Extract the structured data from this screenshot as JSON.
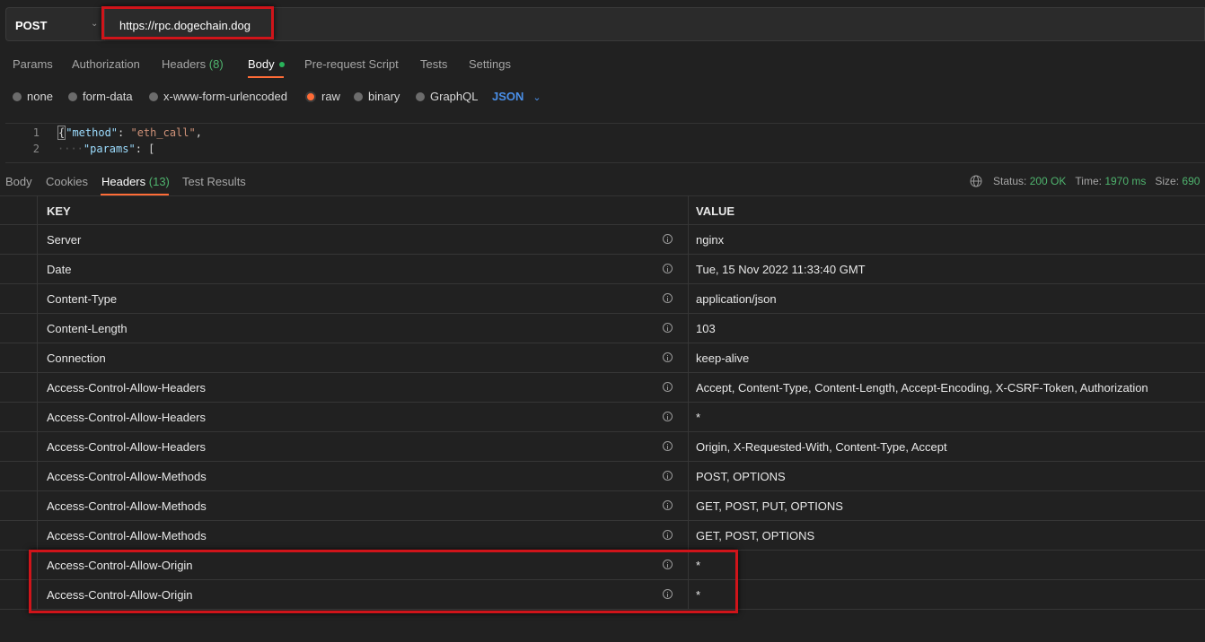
{
  "request": {
    "method": "POST",
    "url": "https://rpc.dogechain.dog"
  },
  "request_tabs": [
    {
      "label": "Params"
    },
    {
      "label": "Authorization"
    },
    {
      "label": "Headers",
      "count": "(8)"
    },
    {
      "label": "Body"
    },
    {
      "label": "Pre-request Script"
    },
    {
      "label": "Tests"
    },
    {
      "label": "Settings"
    }
  ],
  "body_types": [
    "none",
    "form-data",
    "x-www-form-urlencoded",
    "raw",
    "binary",
    "GraphQL"
  ],
  "selected_body_type": "raw",
  "body_format": "JSON",
  "editor": {
    "lines": [
      {
        "n": "1",
        "key": "\"method\"",
        "colon": ": ",
        "value": "\"eth_call\"",
        "tail": ","
      },
      {
        "n": "2",
        "key": "\"params\"",
        "colon": ": ",
        "value": "[",
        "tail": ""
      }
    ]
  },
  "response_tabs": [
    {
      "label": "Body"
    },
    {
      "label": "Cookies"
    },
    {
      "label": "Headers",
      "count": "(13)"
    },
    {
      "label": "Test Results"
    }
  ],
  "status": {
    "status_label": "Status:",
    "status_value": "200 OK",
    "time_label": "Time:",
    "time_value": "1970 ms",
    "size_label": "Size:",
    "size_value": "690"
  },
  "headers_table": {
    "columns": [
      "KEY",
      "VALUE"
    ],
    "rows": [
      {
        "key": "Server",
        "value": "nginx"
      },
      {
        "key": "Date",
        "value": "Tue, 15 Nov 2022 11:33:40 GMT"
      },
      {
        "key": "Content-Type",
        "value": "application/json"
      },
      {
        "key": "Content-Length",
        "value": "103"
      },
      {
        "key": "Connection",
        "value": "keep-alive"
      },
      {
        "key": "Access-Control-Allow-Headers",
        "value": "Accept, Content-Type, Content-Length, Accept-Encoding, X-CSRF-Token, Authorization"
      },
      {
        "key": "Access-Control-Allow-Headers",
        "value": "*"
      },
      {
        "key": "Access-Control-Allow-Headers",
        "value": "Origin, X-Requested-With, Content-Type, Accept"
      },
      {
        "key": "Access-Control-Allow-Methods",
        "value": "POST, OPTIONS"
      },
      {
        "key": "Access-Control-Allow-Methods",
        "value": "GET, POST, PUT, OPTIONS"
      },
      {
        "key": "Access-Control-Allow-Methods",
        "value": "GET, POST, OPTIONS"
      },
      {
        "key": "Access-Control-Allow-Origin",
        "value": "*"
      },
      {
        "key": "Access-Control-Allow-Origin",
        "value": "*"
      }
    ]
  },
  "colors": {
    "accent": "#ff6c37",
    "success": "#4fb46e",
    "link": "#4a8fe8",
    "highlight_box": "#d0141a"
  }
}
